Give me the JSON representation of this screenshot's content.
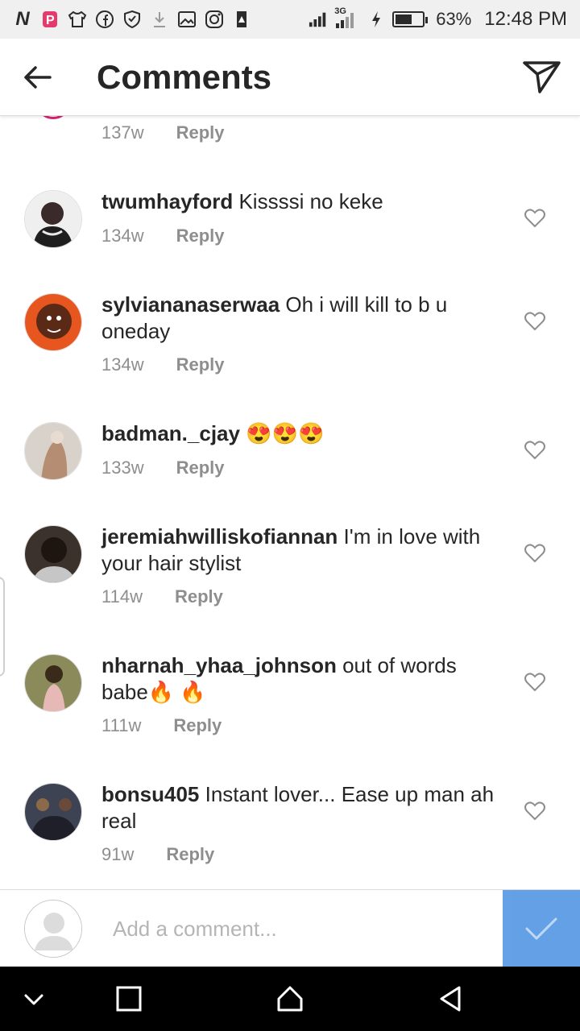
{
  "status_bar": {
    "network_badge": "3G",
    "battery_percent": "63%",
    "battery_level": 0.63,
    "time": "12:48 PM",
    "icons": [
      "n-icon",
      "p-icon",
      "shirt-icon",
      "facebook-icon",
      "shield-icon",
      "download-icon",
      "image-icon",
      "instagram-icon",
      "alert-icon",
      "signal-icon",
      "charging-icon",
      "battery-icon"
    ]
  },
  "header": {
    "title": "Comments"
  },
  "top_partial": {
    "age": "137w",
    "reply_label": "Reply"
  },
  "comments": [
    {
      "username": "twumhayford",
      "text": "Kissssi no keke",
      "age": "134w",
      "reply_label": "Reply",
      "avatar_color": "#3a2a2a"
    },
    {
      "username": "sylviananaserwaa",
      "text": "Oh i will kill to b u oneday",
      "age": "134w",
      "reply_label": "Reply",
      "avatar_color": "#c0471f"
    },
    {
      "username": "badman._cjay",
      "text": "😍😍😍",
      "age": "133w",
      "reply_label": "Reply",
      "avatar_color": "#b9a89a"
    },
    {
      "username": "jeremiahwilliskofiannan",
      "text": "I'm in love with your hair stylist",
      "age": "114w",
      "reply_label": "Reply",
      "avatar_color": "#2b2118"
    },
    {
      "username": "nharnah_yhaa_johnson",
      "text": "out of words babe🔥 🔥",
      "age": "111w",
      "reply_label": "Reply",
      "avatar_color": "#5d4a2c"
    },
    {
      "username": "bonsu405",
      "text": "Instant lover... Ease up man ah real",
      "age": "91w",
      "reply_label": "Reply",
      "avatar_color": "#2d3340"
    }
  ],
  "composer": {
    "placeholder": "Add a comment...",
    "accent_color": "#4a90e2"
  }
}
